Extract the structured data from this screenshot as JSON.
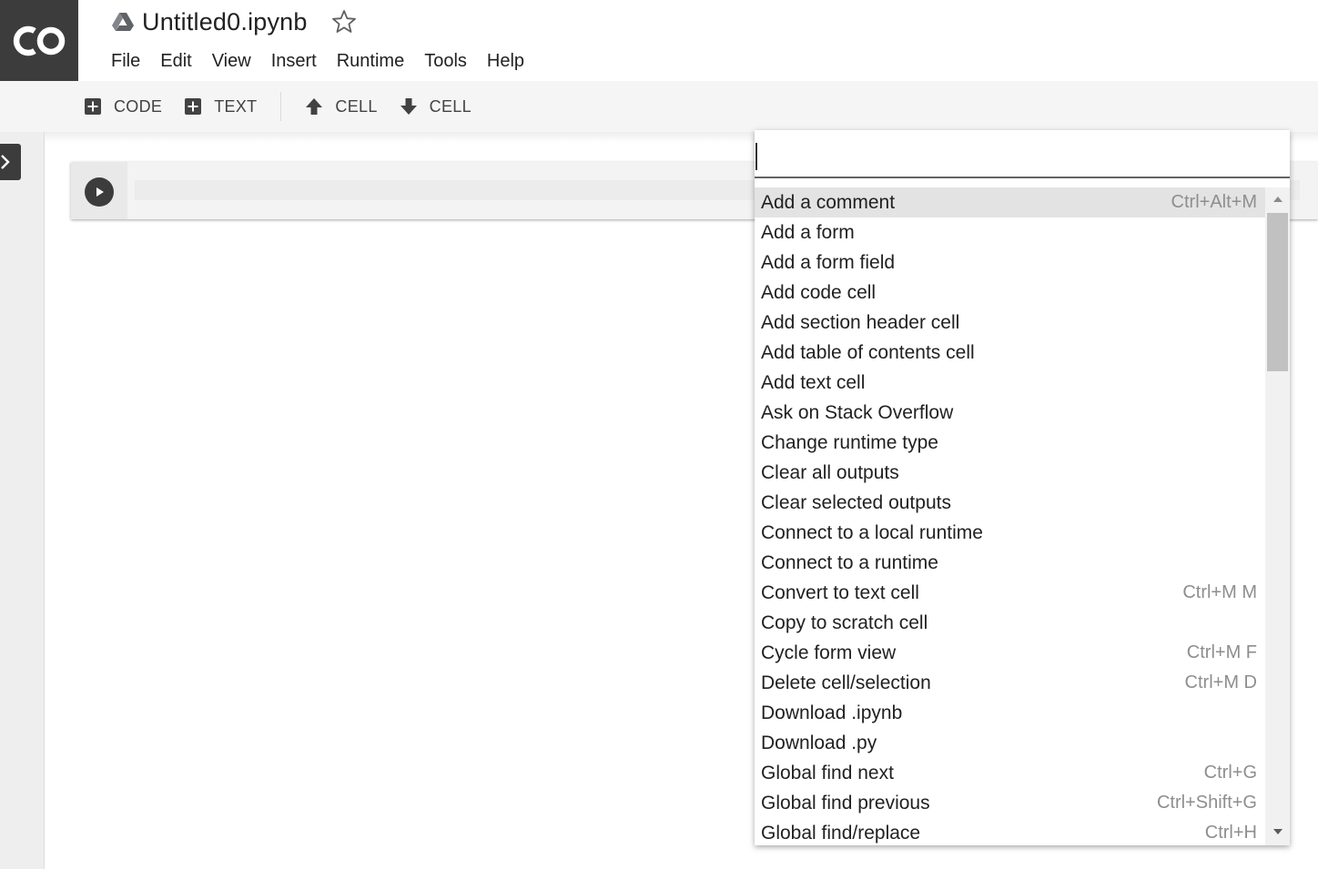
{
  "app": {
    "logo_text": "CO",
    "notebook_title": "Untitled0.ipynb",
    "icons": {
      "drive": "google-drive-icon",
      "star": "star-outline-icon",
      "run": "play-icon",
      "sidebar_toggle": "chevron-right-icon"
    }
  },
  "menubar": {
    "items": [
      {
        "label": "File"
      },
      {
        "label": "Edit"
      },
      {
        "label": "View"
      },
      {
        "label": "Insert"
      },
      {
        "label": "Runtime"
      },
      {
        "label": "Tools"
      },
      {
        "label": "Help"
      }
    ]
  },
  "toolbar": {
    "add_code_label": "CODE",
    "add_text_label": "TEXT",
    "cell_up_label": "CELL",
    "cell_down_label": "CELL"
  },
  "palette": {
    "query": "",
    "selected_index": 0,
    "commands": [
      {
        "label": "Add a comment",
        "shortcut": "Ctrl+Alt+M"
      },
      {
        "label": "Add a form",
        "shortcut": ""
      },
      {
        "label": "Add a form field",
        "shortcut": ""
      },
      {
        "label": "Add code cell",
        "shortcut": ""
      },
      {
        "label": "Add section header cell",
        "shortcut": ""
      },
      {
        "label": "Add table of contents cell",
        "shortcut": ""
      },
      {
        "label": "Add text cell",
        "shortcut": ""
      },
      {
        "label": "Ask on Stack Overflow",
        "shortcut": ""
      },
      {
        "label": "Change runtime type",
        "shortcut": ""
      },
      {
        "label": "Clear all outputs",
        "shortcut": ""
      },
      {
        "label": "Clear selected outputs",
        "shortcut": ""
      },
      {
        "label": "Connect to a local runtime",
        "shortcut": ""
      },
      {
        "label": "Connect to a runtime",
        "shortcut": ""
      },
      {
        "label": "Convert to text cell",
        "shortcut": "Ctrl+M M"
      },
      {
        "label": "Copy to scratch cell",
        "shortcut": ""
      },
      {
        "label": "Cycle form view",
        "shortcut": "Ctrl+M F"
      },
      {
        "label": "Delete cell/selection",
        "shortcut": "Ctrl+M D"
      },
      {
        "label": "Download .ipynb",
        "shortcut": ""
      },
      {
        "label": "Download .py",
        "shortcut": ""
      },
      {
        "label": "Global find next",
        "shortcut": "Ctrl+G"
      },
      {
        "label": "Global find previous",
        "shortcut": "Ctrl+Shift+G"
      },
      {
        "label": "Global find/replace",
        "shortcut": "Ctrl+H"
      }
    ]
  },
  "colors": {
    "chrome_dark": "#3c3c3c",
    "toolbar_bg": "#f5f5f5",
    "selected_row": "#e3e3e3",
    "shortcut_text": "#8e8e8e"
  }
}
